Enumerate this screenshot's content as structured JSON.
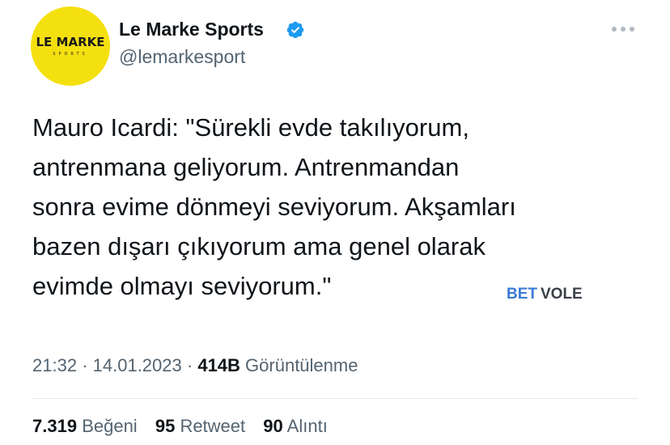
{
  "header": {
    "avatar": {
      "logo_text": "LE MARKE",
      "logo_subtext": "SPORTS",
      "color": "#f5e00f"
    },
    "display_name": "Le Marke Sports",
    "username": "@lemarkesport",
    "verified": true,
    "verified_color": "#1d9bf0",
    "more_icon": "more-horizontal-icon"
  },
  "tweet": {
    "lines": [
      "Mauro Icardi: \"Sürekli evde takılıyorum,",
      "antrenmana geliyorum. Antrenmandan",
      "sonra evime dönmeyi seviyorum. Akşamları",
      "bazen dışarı çıkıyorum ama genel olarak",
      "evimde olmayı seviyorum.\""
    ],
    "watermark": {
      "part1": "BET",
      "part2": "VOLE"
    }
  },
  "meta": {
    "time": "21:32",
    "separator": "·",
    "date": "14.01.2023",
    "views_count": "414B",
    "views_label": "Görüntülenme"
  },
  "stats": {
    "likes_count": "7.319",
    "likes_label": "Beğeni",
    "retweets_count": "95",
    "retweets_label": "Retweet",
    "quotes_count": "90",
    "quotes_label": "Alıntı"
  },
  "colors": {
    "text_primary": "#0f1419",
    "text_secondary": "#536471",
    "divider": "#e3e7ea"
  }
}
